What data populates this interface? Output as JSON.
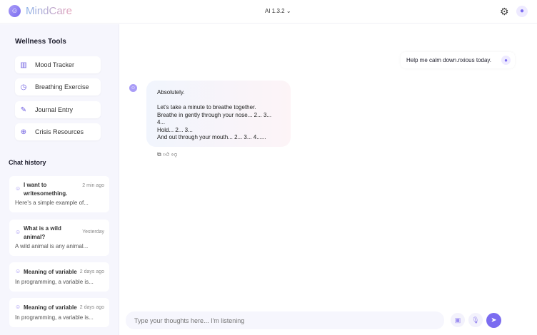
{
  "header": {
    "app_name": "MindCare",
    "model": "AI 1.3.2"
  },
  "sidebar": {
    "wellness_title": "Wellness Tools",
    "tools": [
      {
        "label": "Mood Tracker",
        "icon": "bar-chart-icon"
      },
      {
        "label": "Breathing Exercise",
        "icon": "clock-icon"
      },
      {
        "label": "Journal Entry",
        "icon": "edit-icon"
      },
      {
        "label": "Crisis Resources",
        "icon": "lifebuoy-icon"
      }
    ],
    "history_title": "Chat history",
    "history": [
      {
        "title": "I want to writesomething.",
        "time": "2 min ago",
        "preview": "Here's a simple example of..."
      },
      {
        "title": "What is a wild animal?",
        "time": "Yesterday",
        "preview": "A wild animal is any animal..."
      },
      {
        "title": "Meaning of variable",
        "time": "2 days ago",
        "preview": "In programming, a variable is..."
      },
      {
        "title": "Meaning of variable",
        "time": "2 days ago",
        "preview": "In programming, a variable is..."
      }
    ]
  },
  "chat": {
    "user_message": "Help me calm down.nxious today.",
    "bot_message": "Absolutely.\n\nLet's take a minute to breathe together.\nBreathe in gently through your nose... 2... 3... 4...\nHold... 2... 3...\nAnd out through your mouth... 2... 3... 4......"
  },
  "input": {
    "placeholder": "Type your thoughts here... I'm listening",
    "value": ""
  },
  "colors": {
    "accent": "#7b6cf0",
    "sidebar_bg": "#f6f6fd"
  }
}
